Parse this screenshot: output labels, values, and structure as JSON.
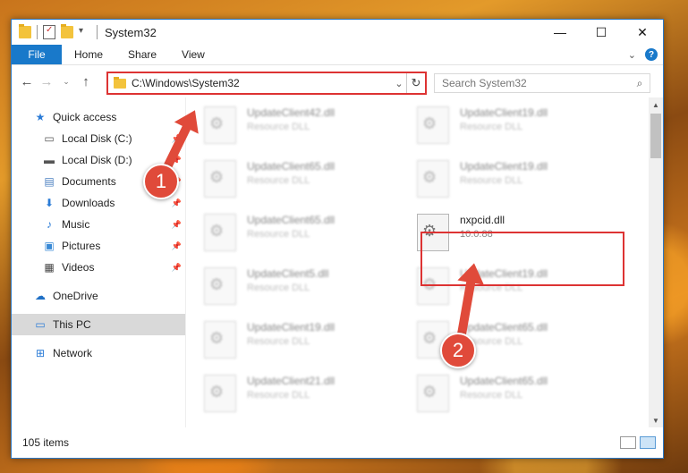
{
  "window": {
    "title": "System32"
  },
  "ribbon": {
    "file": "File",
    "tabs": [
      "Home",
      "Share",
      "View"
    ]
  },
  "address": {
    "path": "C:\\Windows\\System32",
    "search_placeholder": "Search System32"
  },
  "sidebar": {
    "quick_access": "Quick access",
    "items": [
      {
        "label": "Local Disk (C:)"
      },
      {
        "label": "Local Disk (D:)"
      },
      {
        "label": "Documents"
      },
      {
        "label": "Downloads"
      },
      {
        "label": "Music"
      },
      {
        "label": "Pictures"
      },
      {
        "label": "Videos"
      }
    ],
    "onedrive": "OneDrive",
    "this_pc": "This PC",
    "network": "Network"
  },
  "files": [
    {
      "name": "UpdateClient42.dll",
      "desc": "Resource DLL"
    },
    {
      "name": "UpdateClient19.dll",
      "desc": "Resource DLL"
    },
    {
      "name": "UpdateClient65.dll",
      "desc": "Resource DLL"
    },
    {
      "name": "UpdateClient19.dll",
      "desc": "Resource DLL"
    },
    {
      "name": "UpdateClient65.dll",
      "desc": "Resource DLL"
    },
    {
      "name": "nxpcid.dll",
      "desc": "10.0.88"
    },
    {
      "name": "UpdateClient5.dll",
      "desc": "Resource DLL"
    },
    {
      "name": "UpdateClient19.dll",
      "desc": "Resource DLL"
    },
    {
      "name": "UpdateClient19.dll",
      "desc": "Resource DLL"
    },
    {
      "name": "UpdateClient65.dll",
      "desc": "Resource DLL"
    },
    {
      "name": "UpdateClient21.dll",
      "desc": "Resource DLL"
    },
    {
      "name": "UpdateClient65.dll",
      "desc": "Resource DLL"
    }
  ],
  "status": {
    "count": "105 items"
  },
  "annotations": {
    "step1": "1",
    "step2": "2",
    "color": "#e04a3a"
  }
}
